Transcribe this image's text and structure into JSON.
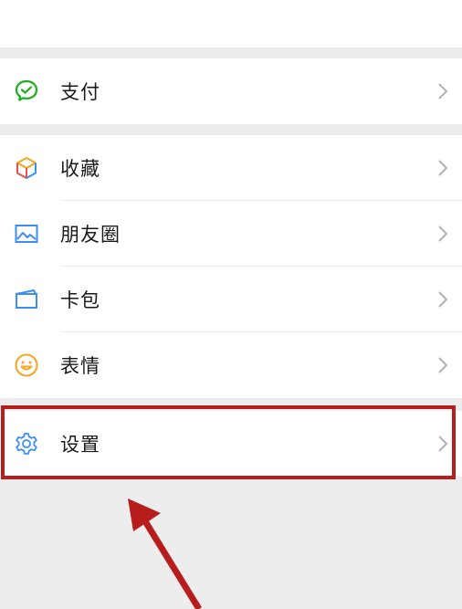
{
  "menu": {
    "pay": {
      "label": "支付",
      "icon": "wechat-pay-icon"
    },
    "favorites": {
      "label": "收藏",
      "icon": "cube-icon"
    },
    "moments": {
      "label": "朋友圈",
      "icon": "image-icon"
    },
    "card_wallet": {
      "label": "卡包",
      "icon": "card-wallet-icon"
    },
    "stickers": {
      "label": "表情",
      "icon": "smiley-icon"
    },
    "settings": {
      "label": "设置",
      "icon": "gear-icon"
    }
  },
  "colors": {
    "background": "#ededed",
    "card": "#ffffff",
    "highlight": "#b81d1d",
    "arrow": "#b81d1d"
  }
}
